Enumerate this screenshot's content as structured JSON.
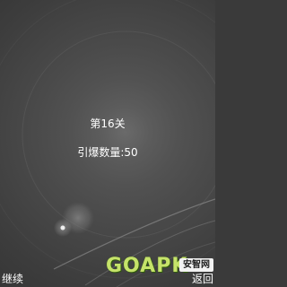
{
  "level": {
    "title": "第16关"
  },
  "stats": {
    "detonation_label": "引爆数量:50"
  },
  "softkeys": {
    "left": "继续",
    "right": "返回"
  },
  "watermark": {
    "brand": "GOAPK",
    "badge": "安智网"
  },
  "colors": {
    "text": "#ffffff",
    "watermark_green": "#c6e36a"
  }
}
